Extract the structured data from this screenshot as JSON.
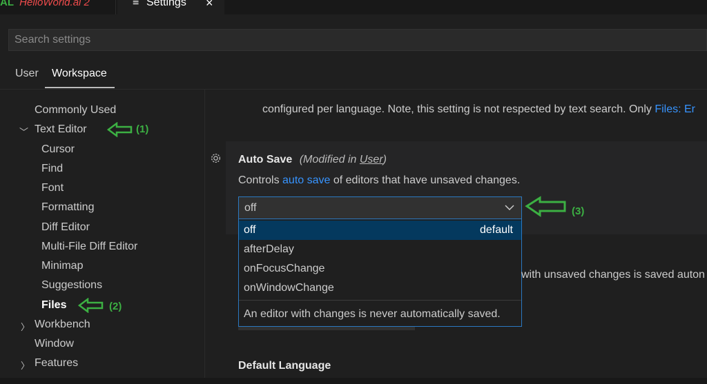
{
  "tabs": [
    {
      "lang": "AL",
      "label": "HelloWorld.al 2"
    },
    {
      "label": "Settings",
      "icon": "settings-lines-icon",
      "close": "×"
    }
  ],
  "search": {
    "placeholder": "Search settings"
  },
  "scope_tabs": [
    {
      "label": "User"
    },
    {
      "label": "Workspace",
      "active": true
    }
  ],
  "sidebar": {
    "items": [
      {
        "label": "Commonly Used",
        "level": 0
      },
      {
        "label": "Text Editor",
        "level": 0,
        "chevron": "expanded"
      },
      {
        "label": "Cursor",
        "level": 1
      },
      {
        "label": "Find",
        "level": 1
      },
      {
        "label": "Font",
        "level": 1
      },
      {
        "label": "Formatting",
        "level": 1
      },
      {
        "label": "Diff Editor",
        "level": 1
      },
      {
        "label": "Multi-File Diff Editor",
        "level": 1
      },
      {
        "label": "Minimap",
        "level": 1
      },
      {
        "label": "Suggestions",
        "level": 1
      },
      {
        "label": "Files",
        "level": 1,
        "active": true
      },
      {
        "label": "Workbench",
        "level": 0,
        "chevron": "collapsed"
      },
      {
        "label": "Window",
        "level": 0
      },
      {
        "label": "Features",
        "level": 0,
        "chevron": "collapsed"
      }
    ]
  },
  "annotations": {
    "a1": "(1)",
    "a2": "(2)",
    "a3": "(3)",
    "color": "#3cb043"
  },
  "main": {
    "prev_desc_a": "configured per language. Note, this setting is not respected by text search. Only ",
    "prev_desc_link": "Files: Er",
    "autosave": {
      "title": "Auto Save",
      "modified_a": "(Modified in ",
      "modified_link": "User",
      "modified_b": ")",
      "desc_a": "Controls ",
      "desc_link": "auto save",
      "desc_b": " of editors that have unsaved changes.",
      "value": "off",
      "options": [
        "off",
        "afterDelay",
        "onFocusChange",
        "onWindowChange"
      ],
      "default_label": "default",
      "option_desc": "An editor with changes is never automatically saved."
    },
    "next_desc": "with unsaved changes is saved auton",
    "default_language_title": "Default Language"
  }
}
